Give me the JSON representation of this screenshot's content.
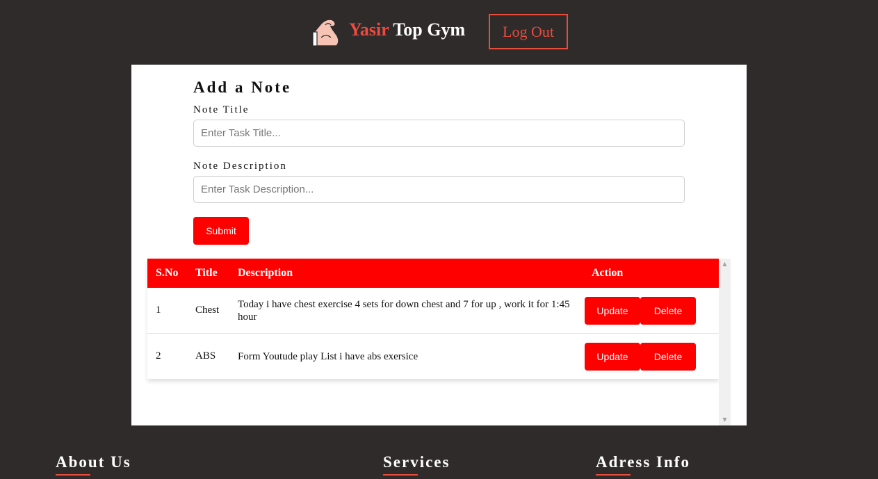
{
  "header": {
    "brand_accent": "Yasir",
    "brand_rest": "Top Gym",
    "logout_label": "Log Out",
    "logo_icon": "flexed-arm-icon"
  },
  "form": {
    "title": "Add a Note",
    "title_label": "Note Title",
    "title_placeholder": "Enter Task Title...",
    "title_value": "",
    "description_label": "Note Description",
    "description_placeholder": "Enter Task Description...",
    "description_value": "",
    "submit_label": "Submit"
  },
  "table": {
    "columns": [
      "S.No",
      "Title",
      "Description",
      "Action"
    ],
    "rows": [
      {
        "sno": "1",
        "title": "Chest",
        "description": "Today i have chest exercise 4 sets for down chest and 7 for up , work it for 1:45 hour",
        "update_label": "Update",
        "delete_label": "Delete"
      },
      {
        "sno": "2",
        "title": "ABS",
        "description": "Form Youtude play List i have abs exersice",
        "update_label": "Update",
        "delete_label": "Delete"
      }
    ]
  },
  "footer": {
    "about": "About Us",
    "services": "Services",
    "address": "Adress Info"
  },
  "colors": {
    "background": "#2f2b2b",
    "accent": "#ff0000",
    "brand_accent": "#ee4a3f"
  }
}
